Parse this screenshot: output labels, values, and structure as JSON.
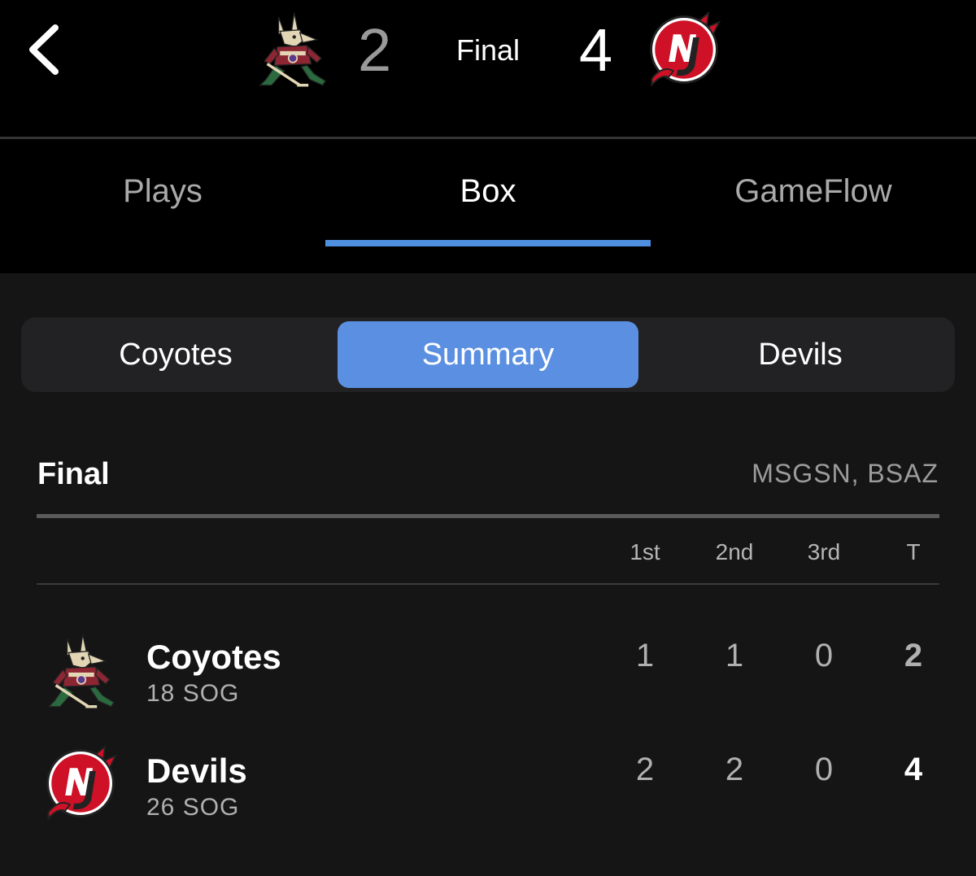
{
  "header": {
    "away_team": "Coyotes",
    "home_team": "Devils",
    "away_score": "2",
    "home_score": "4",
    "status": "Final",
    "back_icon": "chevron-left-icon"
  },
  "tabs": [
    {
      "label": "Plays",
      "active": false
    },
    {
      "label": "Box",
      "active": true
    },
    {
      "label": "GameFlow",
      "active": false
    }
  ],
  "segments": [
    {
      "label": "Coyotes",
      "selected": false
    },
    {
      "label": "Summary",
      "selected": true
    },
    {
      "label": "Devils",
      "selected": false
    }
  ],
  "summary": {
    "title": "Final",
    "networks": "MSGSN, BSAZ",
    "columns": [
      "1st",
      "2nd",
      "3rd",
      "T"
    ],
    "rows": [
      {
        "team": "Coyotes",
        "sog": "18 SOG",
        "periods": [
          "1",
          "1",
          "0"
        ],
        "total": "2"
      },
      {
        "team": "Devils",
        "sog": "26 SOG",
        "periods": [
          "2",
          "2",
          "0"
        ],
        "total": "4"
      }
    ]
  },
  "colors": {
    "accent": "#4f8fe0",
    "segment_selected": "#5b8fe1",
    "devils_red": "#ce1126",
    "coyotes_brick": "#8c2633",
    "coyotes_sand": "#e2d6b5"
  }
}
